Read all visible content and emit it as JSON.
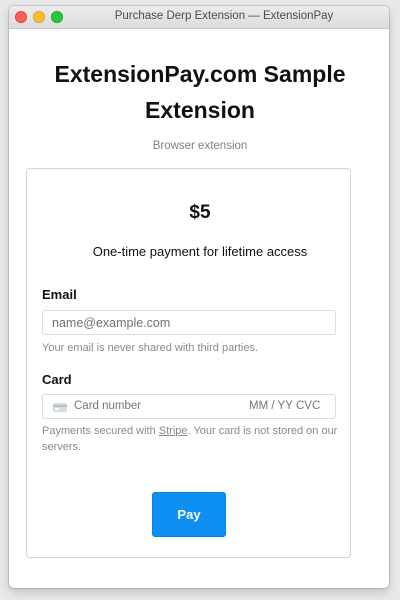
{
  "window": {
    "title": "Purchase Derp Extension — ExtensionPay"
  },
  "page": {
    "title": "ExtensionPay.com Sample Extension",
    "subtitle": "Browser extension"
  },
  "payment": {
    "price": "$5",
    "description": "One-time payment for lifetime access"
  },
  "email": {
    "label": "Email",
    "placeholder": "name@example.com",
    "help": "Your email is never shared with third parties."
  },
  "card": {
    "label": "Card",
    "number_placeholder": "Card number",
    "expiry_placeholder": "MM / YY",
    "cvc_placeholder": "CVC",
    "icon": "credit-card-icon",
    "help_prefix": "Payments secured with ",
    "help_link": "Stripe",
    "help_suffix": ". Your card is not stored on our servers."
  },
  "pay_button": {
    "label": "Pay",
    "color": "#0e8ff2"
  },
  "colors": {
    "close": "#fe5f57",
    "minimize": "#febc2e",
    "maximize": "#28c840"
  }
}
